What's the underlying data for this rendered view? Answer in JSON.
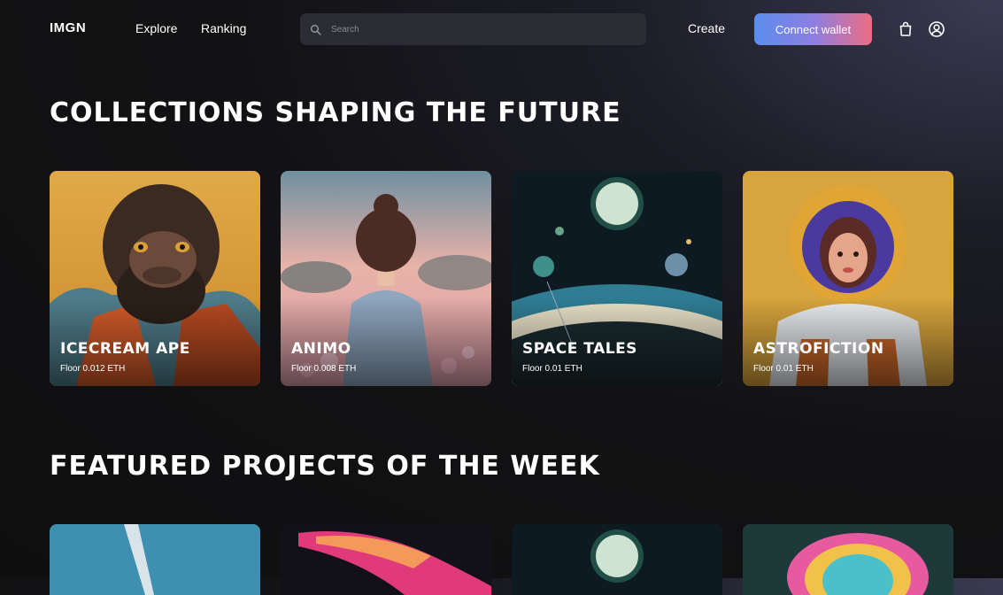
{
  "nav": {
    "logo": "IMGN",
    "links": [
      "Explore",
      "Ranking"
    ],
    "search_placeholder": "Search",
    "create": "Create",
    "connect_wallet": "Connect wallet"
  },
  "sections": [
    {
      "title": "COLLECTIONS SHAPING THE FUTURE",
      "cards": [
        {
          "name": "ICECREAM APE",
          "floor": "Floor 0.012 ETH"
        },
        {
          "name": "ANIMO",
          "floor": "Floor 0.008 ETH"
        },
        {
          "name": "SPACE TALES",
          "floor": "Floor 0.01 ETH"
        },
        {
          "name": "ASTROFICTION",
          "floor": "Floor 0.01 ETH"
        }
      ]
    },
    {
      "title": "FEATURED PROJECTS OF THE WEEK"
    }
  ],
  "colors": {
    "background": "#0f0f10",
    "search_bg": "#2c2c34",
    "wallet_gradient": [
      "#5b8def",
      "#8c7fe0",
      "#ee6c83"
    ]
  },
  "icons": [
    "search-icon",
    "shopping-bag-icon",
    "user-circle-icon"
  ]
}
